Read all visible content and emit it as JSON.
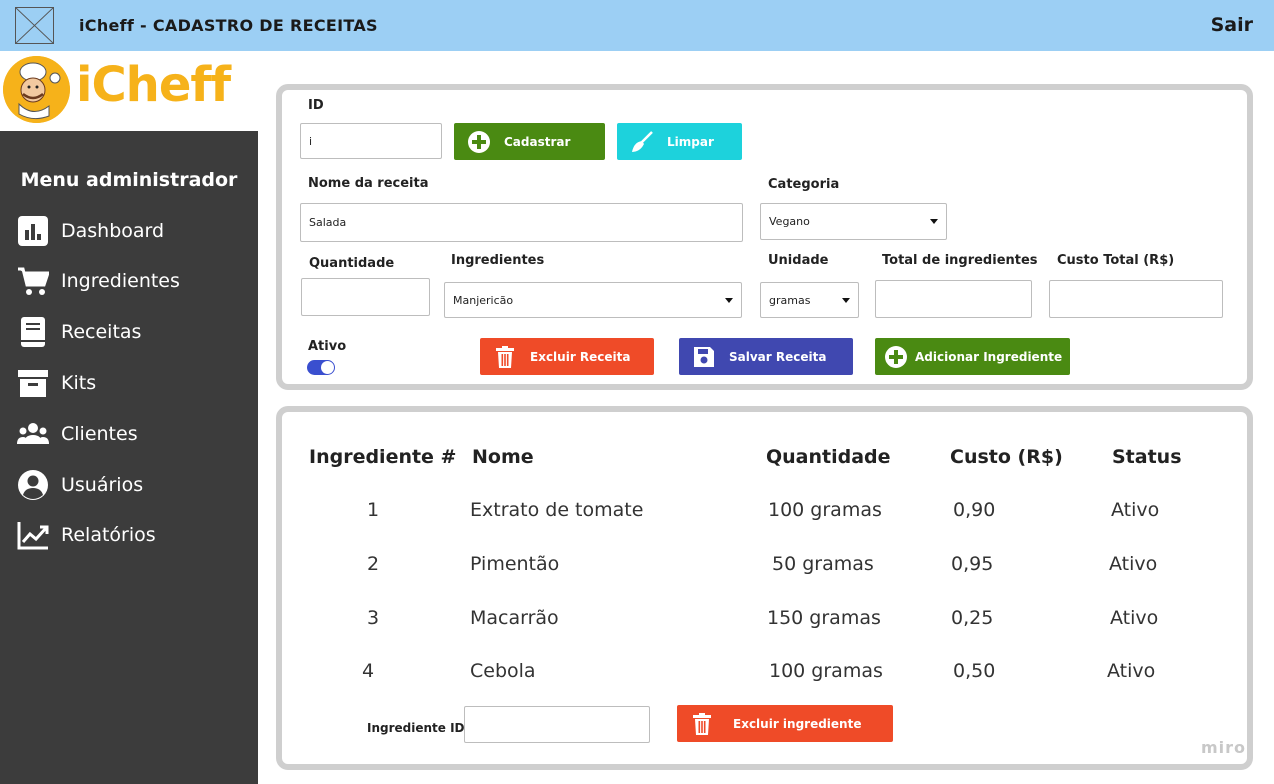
{
  "header": {
    "title": "iCheff - CADASTRO DE RECEITAS",
    "logout_label": "Sair"
  },
  "sidebar": {
    "brand": "iCheff",
    "menu_title": "Menu administrador",
    "items": [
      {
        "label": "Dashboard",
        "icon": "chart-icon"
      },
      {
        "label": "Ingredientes",
        "icon": "cart-icon"
      },
      {
        "label": "Receitas",
        "icon": "book-icon"
      },
      {
        "label": "Kits",
        "icon": "archive-icon"
      },
      {
        "label": "Clientes",
        "icon": "users-icon"
      },
      {
        "label": "Usuários",
        "icon": "user-circle-icon"
      },
      {
        "label": "Relatórios",
        "icon": "trend-chart-icon"
      }
    ]
  },
  "form": {
    "id_label": "ID",
    "id_value": "i",
    "register_button": "Cadastrar",
    "clear_button": "Limpar",
    "recipe_name_label": "Nome da receita",
    "recipe_name_value": "Salada",
    "category_label": "Categoria",
    "category_value": "Vegano",
    "quantity_label": "Quantidade",
    "quantity_value": "",
    "ingredients_label": "Ingredientes",
    "ingredients_value": "Manjericão",
    "unit_label": "Unidade",
    "unit_value": "gramas",
    "total_ingredients_label": "Total de ingredientes",
    "total_ingredients_value": "",
    "total_cost_label": "Custo Total (R$)",
    "total_cost_value": "",
    "active_label": "Ativo",
    "active_on": true,
    "delete_recipe_button": "Excluir Receita",
    "save_recipe_button": "Salvar Receita",
    "add_ingredient_button": "Adicionar Ingrediente"
  },
  "table": {
    "columns": [
      "Ingrediente #",
      "Nome",
      "Quantidade",
      "Custo (R$)",
      "Status"
    ],
    "rows": [
      {
        "num": "1",
        "name": "Extrato de tomate",
        "qty": "100 gramas",
        "cost": "0,90",
        "status": "Ativo"
      },
      {
        "num": "2",
        "name": "Pimentão",
        "qty": "50 gramas",
        "cost": "0,95",
        "status": "Ativo"
      },
      {
        "num": "3",
        "name": "Macarrão",
        "qty": "150 gramas",
        "cost": "0,25",
        "status": "Ativo"
      },
      {
        "num": "4",
        "name": "Cebola",
        "qty": "100 gramas",
        "cost": "0,50",
        "status": "Ativo"
      }
    ],
    "ingredient_id_label": "Ingrediente ID",
    "ingredient_id_value": "",
    "delete_ingredient_button": "Excluir ingrediente"
  },
  "watermark": "miro",
  "colors": {
    "topbar": "#9ccff4",
    "sidebar": "#3c3c3c",
    "brand": "#f6b21a",
    "green": "#4a8a12",
    "cyan": "#1dd2dc",
    "red": "#ef4b28",
    "blue": "#4048b0"
  }
}
